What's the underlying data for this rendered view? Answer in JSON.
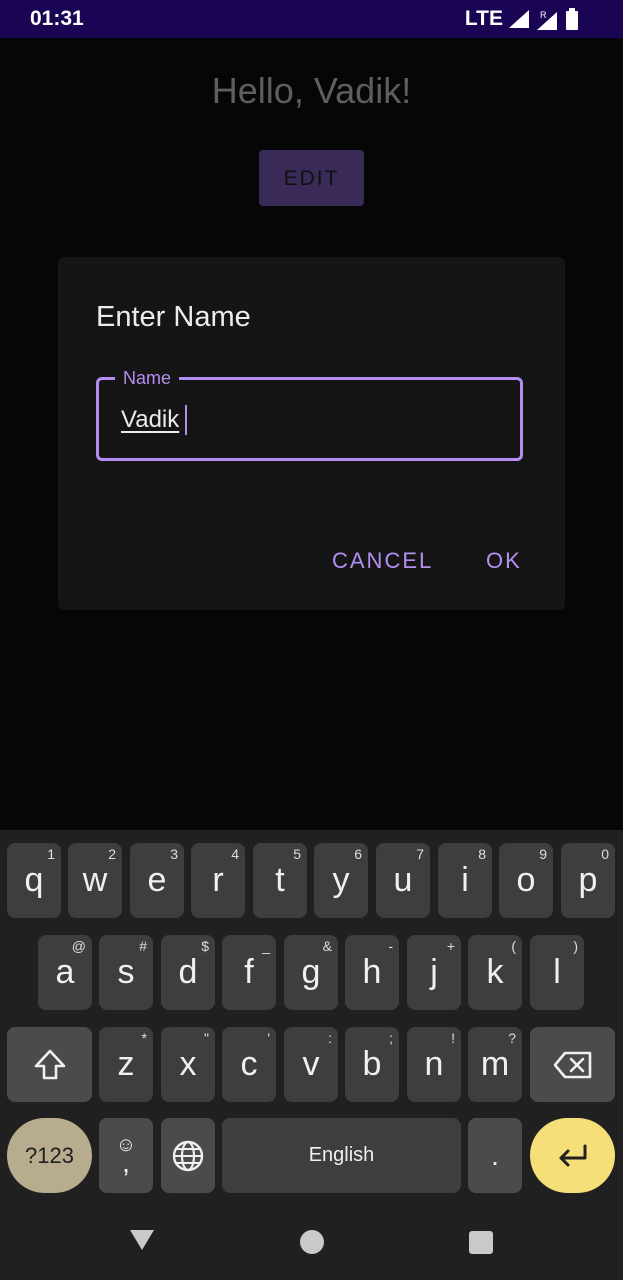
{
  "status_bar": {
    "time": "01:31",
    "network": "LTE",
    "roaming": "R"
  },
  "app": {
    "greeting": "Hello, Vadik!",
    "edit_label": "EDIT"
  },
  "dialog": {
    "title": "Enter Name",
    "field_label": "Name",
    "field_value": "Vadik",
    "cancel_label": "CANCEL",
    "ok_label": "OK"
  },
  "keyboard": {
    "row1": [
      {
        "letter": "q",
        "alt": "1"
      },
      {
        "letter": "w",
        "alt": "2"
      },
      {
        "letter": "e",
        "alt": "3"
      },
      {
        "letter": "r",
        "alt": "4"
      },
      {
        "letter": "t",
        "alt": "5"
      },
      {
        "letter": "y",
        "alt": "6"
      },
      {
        "letter": "u",
        "alt": "7"
      },
      {
        "letter": "i",
        "alt": "8"
      },
      {
        "letter": "o",
        "alt": "9"
      },
      {
        "letter": "p",
        "alt": "0"
      }
    ],
    "row2": [
      {
        "letter": "a",
        "alt": "@"
      },
      {
        "letter": "s",
        "alt": "#"
      },
      {
        "letter": "d",
        "alt": "$"
      },
      {
        "letter": "f",
        "alt": "_"
      },
      {
        "letter": "g",
        "alt": "&"
      },
      {
        "letter": "h",
        "alt": "-"
      },
      {
        "letter": "j",
        "alt": "+"
      },
      {
        "letter": "k",
        "alt": "("
      },
      {
        "letter": "l",
        "alt": ")"
      }
    ],
    "row3": [
      {
        "letter": "z",
        "alt": "*"
      },
      {
        "letter": "x",
        "alt": "\""
      },
      {
        "letter": "c",
        "alt": "'"
      },
      {
        "letter": "v",
        "alt": ":"
      },
      {
        "letter": "b",
        "alt": ";"
      },
      {
        "letter": "n",
        "alt": "!"
      },
      {
        "letter": "m",
        "alt": "?"
      }
    ],
    "symbols_label": "?123",
    "emoji_label": "☺",
    "comma_label": ",",
    "space_label": "English",
    "period_label": "."
  },
  "colors": {
    "accent": "#b48ef0",
    "status_bar": "#1a0555",
    "enter_key": "#f6de78"
  }
}
